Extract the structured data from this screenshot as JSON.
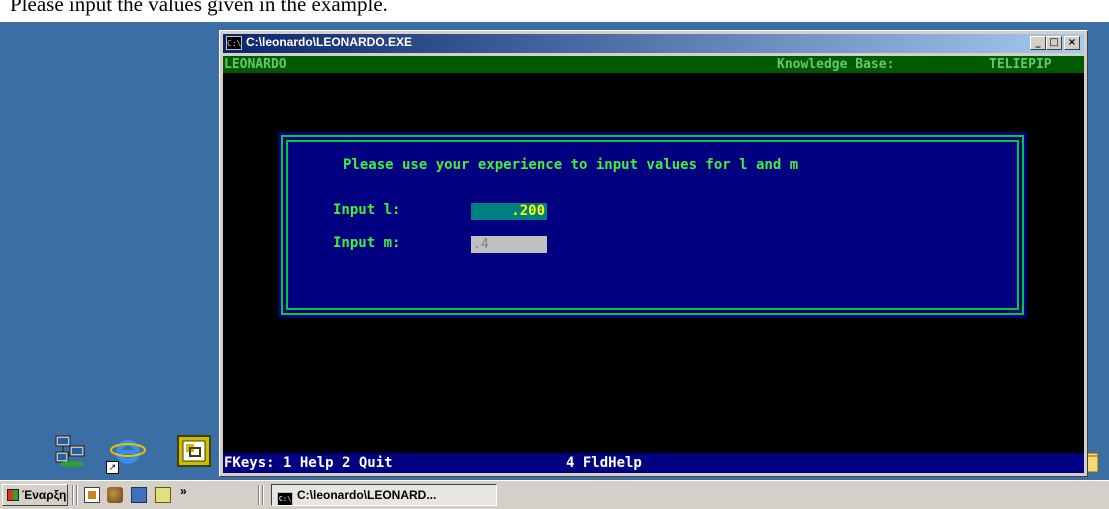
{
  "page": {
    "top_text": "Please input the values given in the example."
  },
  "window": {
    "title": "C:\\leonardo\\LEONARDO.EXE",
    "system_icon": "C:\\",
    "buttons": {
      "minimize": "_",
      "maximize": "□",
      "close": "×"
    }
  },
  "app": {
    "name": "LEONARDO",
    "kb_label": "Knowledge Base:",
    "kb_value": "TELIEPIP"
  },
  "dialog": {
    "prompt": "Please use your experience to input values for l and m",
    "fields": [
      {
        "label": "Input l:",
        "value": ".200"
      },
      {
        "label": "Input m:",
        "value": ".4"
      }
    ],
    "border_color": "#00cc33",
    "background": "#000080"
  },
  "fkeys": {
    "left": "FKeys: 1 Help 2 Quit",
    "right": "4 FldHelp"
  },
  "desktop_icons": [
    "network-neighborhood-icon",
    "internet-explorer-icon",
    "ms-dos-icon",
    "folder-icon"
  ],
  "taskbar": {
    "start_label": "Έναρξη",
    "quicklaunch": [
      "show-desktop-icon",
      "address-book-icon",
      "network-icon",
      "scheduler-icon"
    ],
    "more": "»",
    "task_label": "C:\\leonardo\\LEONARD...",
    "task_icon": "C:\\"
  },
  "colors": {
    "desktop": "#3a6ea5",
    "titlebar": "#0a246a",
    "console_text": "#3cf23c",
    "input_active": "#007f7f",
    "input_value_active": "#ffff00"
  }
}
